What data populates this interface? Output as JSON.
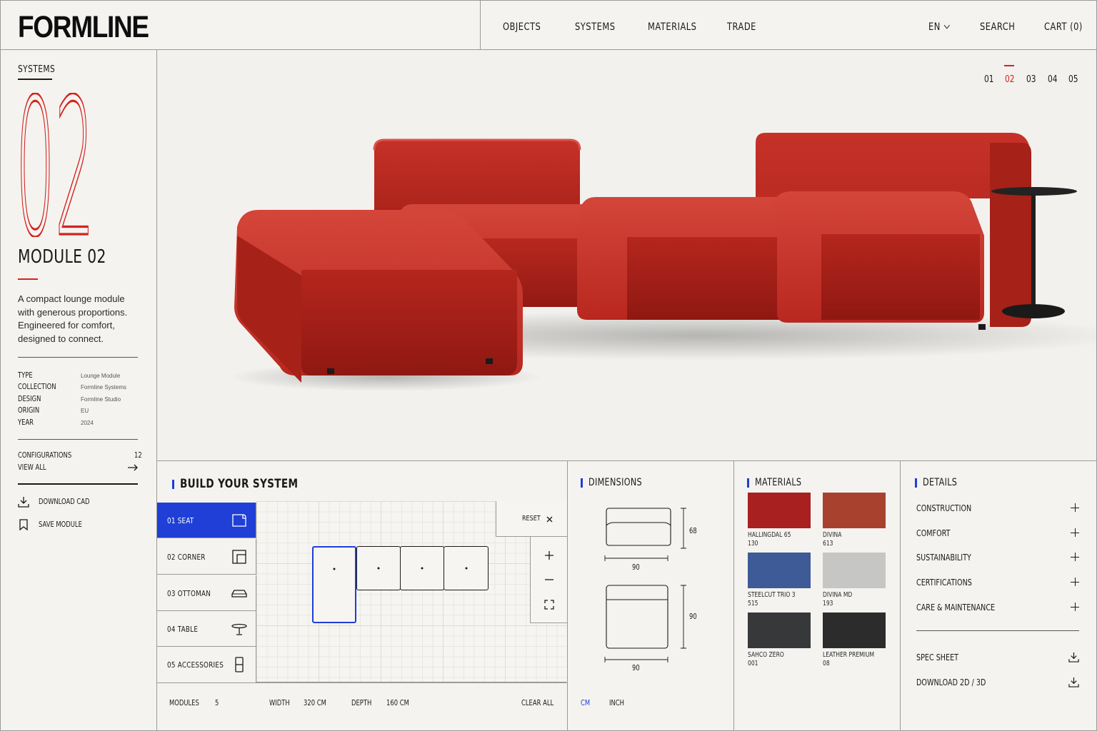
{
  "brand": {
    "logo": "FORMLINE"
  },
  "nav": {
    "items": [
      "OBJECTS",
      "SYSTEMS",
      "MATERIALS",
      "TRADE"
    ],
    "language": "EN",
    "search": "SEARCH",
    "cart": "CART (0)"
  },
  "sidebar": {
    "section": "SYSTEMS",
    "big_number": "02",
    "module_title": "MODULE 02",
    "description": "A compact lounge module with generous proportions. Engineered for comfort, designed to connect.",
    "specs": [
      {
        "key": "TYPE",
        "value": "Lounge Module"
      },
      {
        "key": "COLLECTION",
        "value": "Formline Systems"
      },
      {
        "key": "DESIGN",
        "value": "Formline Studio"
      },
      {
        "key": "ORIGIN",
        "value": "EU"
      },
      {
        "key": "YEAR",
        "value": "2024"
      }
    ],
    "configurations_label": "CONFIGURATIONS",
    "configurations_count": "12",
    "view_all": "VIEW ALL",
    "download_cad": "DOWNLOAD CAD",
    "save_module": "SAVE MODULE"
  },
  "hero": {
    "pager": [
      "01",
      "02",
      "03",
      "04",
      "05"
    ],
    "active_page": "02",
    "accent": "#d3231c"
  },
  "builder": {
    "title": "BUILD YOUR SYSTEM",
    "items": [
      {
        "label": "01  SEAT",
        "icon": "seat-icon",
        "active": true
      },
      {
        "label": "02  CORNER",
        "icon": "corner-icon",
        "active": false
      },
      {
        "label": "03  OTTOMAN",
        "icon": "ottoman-icon",
        "active": false
      },
      {
        "label": "04  TABLE",
        "icon": "table-icon",
        "active": false
      },
      {
        "label": "05  ACCESSORIES",
        "icon": "accessories-icon",
        "active": false
      }
    ],
    "reset": "RESET",
    "footer": {
      "modules_label": "MODULES",
      "modules_value": "5",
      "width_label": "WIDTH",
      "width_value": "320 CM",
      "depth_label": "DEPTH",
      "depth_value": "160 CM",
      "clear_all": "CLEAR ALL"
    },
    "accent": "#1f3fd6"
  },
  "dimensions": {
    "title": "DIMENSIONS",
    "front_height": "68",
    "front_width": "90",
    "top_depth": "90",
    "top_width": "90",
    "unit_cm": "CM",
    "unit_inch": "INCH"
  },
  "materials": {
    "title": "MATERIALS",
    "swatches": [
      {
        "name": "HALLINGDAL 65",
        "code": "130",
        "color": "#a8201f"
      },
      {
        "name": "DIVINA",
        "code": "613",
        "color": "#a9412f"
      },
      {
        "name": "STEELCUT TRIO 3",
        "code": "515",
        "color": "#3e5a97"
      },
      {
        "name": "DIVINA MD",
        "code": "193",
        "color": "#c6c6c4"
      },
      {
        "name": "SAHCO ZERO",
        "code": "001",
        "color": "#36383a"
      },
      {
        "name": "LEATHER PREMIUM",
        "code": "08",
        "color": "#2c2c2c"
      }
    ]
  },
  "details": {
    "title": "DETAILS",
    "items": [
      "CONSTRUCTION",
      "COMFORT",
      "SUSTAINABILITY",
      "CERTIFICATIONS",
      "CARE & MAINTENANCE"
    ],
    "downloads": [
      "SPEC SHEET",
      "DOWNLOAD 2D / 3D"
    ]
  }
}
